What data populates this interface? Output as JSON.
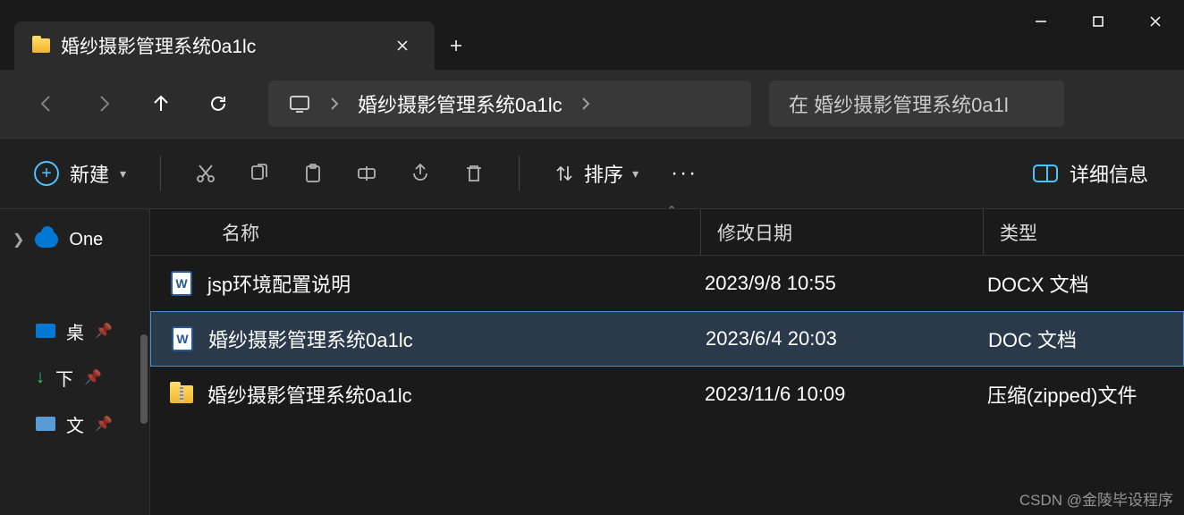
{
  "window": {
    "tab_title": "婚纱摄影管理系统0a1lc"
  },
  "breadcrumb": {
    "current": "婚纱摄影管理系统0a1lc"
  },
  "search": {
    "placeholder": "在 婚纱摄影管理系统0a1l"
  },
  "toolbar": {
    "new_label": "新建",
    "sort_label": "排序",
    "view_label": "详细信息"
  },
  "sidebar": {
    "items": [
      {
        "label": "One"
      },
      {
        "label": "桌"
      },
      {
        "label": "下"
      },
      {
        "label": "文"
      }
    ]
  },
  "columns": {
    "name": "名称",
    "date": "修改日期",
    "type": "类型"
  },
  "files": [
    {
      "name": "jsp环境配置说明",
      "date": "2023/9/8 10:55",
      "type": "DOCX 文档",
      "icon": "doc"
    },
    {
      "name": "婚纱摄影管理系统0a1lc",
      "date": "2023/6/4 20:03",
      "type": "DOC 文档",
      "icon": "doc",
      "selected": true
    },
    {
      "name": "婚纱摄影管理系统0a1lc",
      "date": "2023/11/6 10:09",
      "type": "压缩(zipped)文件",
      "icon": "zip"
    }
  ],
  "watermark": "CSDN @金陵毕设程序"
}
